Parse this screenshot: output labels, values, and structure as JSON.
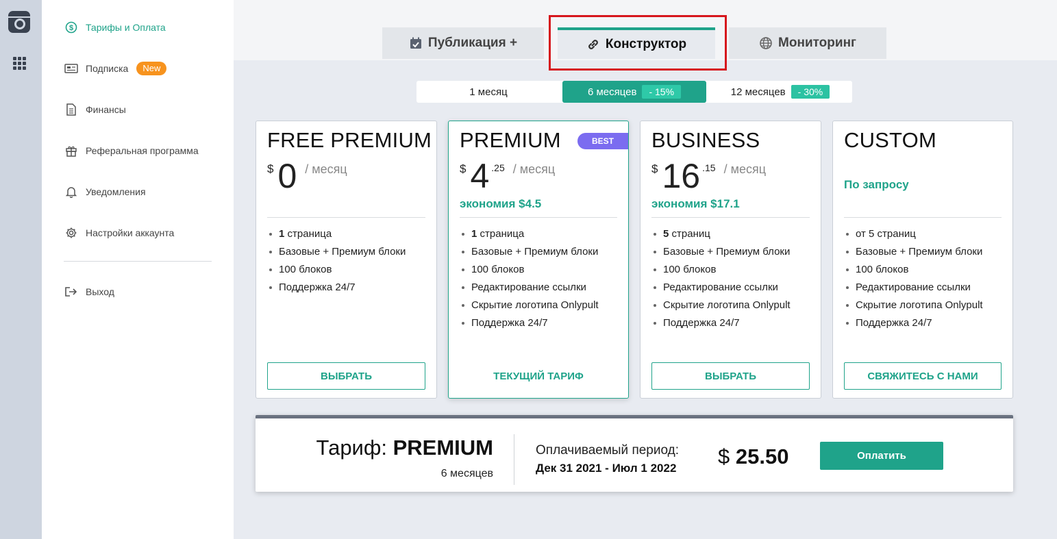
{
  "sidebar": {
    "items": [
      {
        "label": "Тарифы и Оплата",
        "icon": "dollar-circle-icon"
      },
      {
        "label": "Подписка",
        "icon": "subscription-icon",
        "badge": "New"
      },
      {
        "label": "Финансы",
        "icon": "document-icon"
      },
      {
        "label": "Реферальная программа",
        "icon": "gift-icon"
      },
      {
        "label": "Уведомления",
        "icon": "bell-icon"
      },
      {
        "label": "Настройки аккаунта",
        "icon": "gear-icon"
      }
    ],
    "logout": {
      "label": "Выход",
      "icon": "logout-icon"
    }
  },
  "tabs": [
    {
      "label": "Публикация +",
      "icon": "calendar-check-icon"
    },
    {
      "label": "Конструктор",
      "icon": "link-icon",
      "active": true
    },
    {
      "label": "Мониторинг",
      "icon": "globe-icon"
    }
  ],
  "periods": [
    {
      "label": "1 месяц"
    },
    {
      "label": "6 месяцев",
      "discount": "- 15%",
      "active": true
    },
    {
      "label": "12 месяцев",
      "discount": "- 30%"
    }
  ],
  "plans": [
    {
      "name": "FREE PREMIUM",
      "currency": "$",
      "price_int": "0",
      "price_cents": "",
      "per": "/ месяц",
      "features": [
        "1 страница",
        "Базовые + Премиум блоки",
        "100 блоков",
        "Поддержка 24/7"
      ],
      "bold_prefix": "1",
      "button": "ВЫБРАТЬ"
    },
    {
      "name": "PREMIUM",
      "badge": "BEST",
      "currency": "$",
      "price_int": "4",
      "price_cents": ".25",
      "per": "/ месяц",
      "savings": "экономия $4.5",
      "features": [
        "1 страница",
        "Базовые + Премиум блоки",
        "100 блоков",
        "Редактирование ссылки",
        "Скрытие логотипа Onlypult",
        "Поддержка 24/7"
      ],
      "bold_prefix": "1",
      "button": "ТЕКУЩИЙ ТАРИФ"
    },
    {
      "name": "BUSINESS",
      "currency": "$",
      "price_int": "16",
      "price_cents": ".15",
      "per": "/ месяц",
      "savings": "экономия $17.1",
      "features": [
        "5 страниц",
        "Базовые + Премиум блоки",
        "100 блоков",
        "Редактирование ссылки",
        "Скрытие логотипа Onlypult",
        "Поддержка 24/7"
      ],
      "bold_prefix": "5",
      "button": "ВЫБРАТЬ"
    },
    {
      "name": "CUSTOM",
      "on_request": "По запросу",
      "features": [
        "от 5 страниц",
        "Базовые + Премиум блоки",
        "100 блоков",
        "Редактирование ссылки",
        "Скрытие логотипа Onlypult",
        "Поддержка 24/7"
      ],
      "button": "СВЯЖИТЕСЬ С НАМИ"
    }
  ],
  "summary": {
    "plan_prefix": "Тариф: ",
    "plan_name": "PREMIUM",
    "months": "6 месяцев",
    "period_label": "Оплачиваемый период:",
    "period": "Дек 31 2021 - Июл 1 2022",
    "currency": "$",
    "total": "25.50",
    "pay_button": "Оплатить"
  },
  "colors": {
    "accent": "#1fa38a",
    "badge_new": "#f7931e",
    "badge_best": "#7b6cf0",
    "highlight": "#d6161d"
  }
}
